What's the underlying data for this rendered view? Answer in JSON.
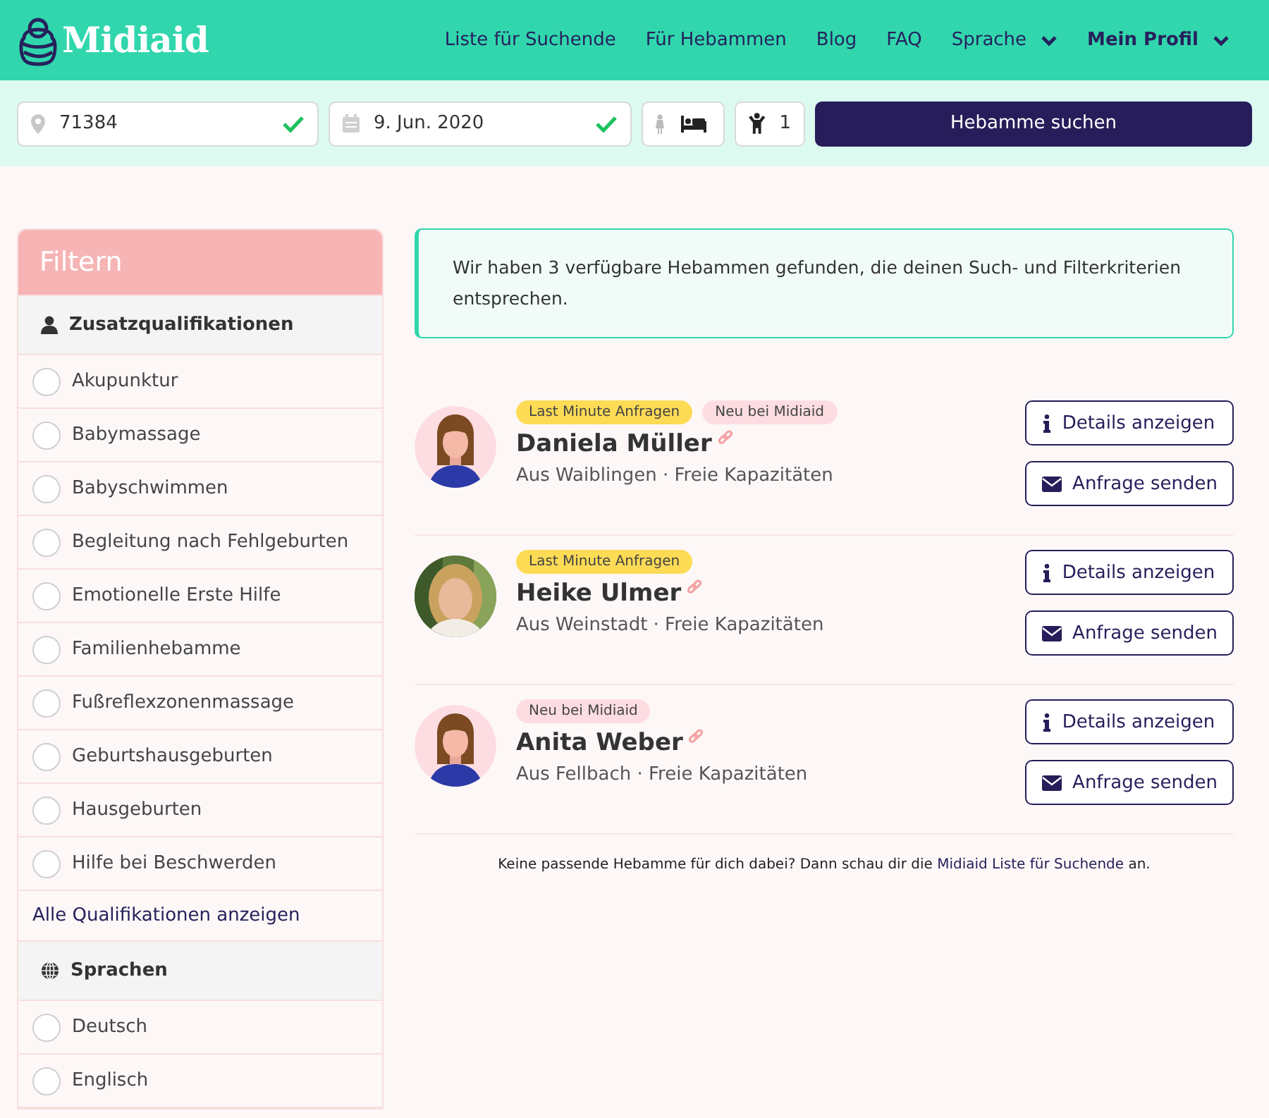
{
  "header": {
    "logo": "Midiaid",
    "nav": [
      {
        "label": "Liste für Suchende",
        "bold": false,
        "dropdown": false
      },
      {
        "label": "Für Hebammen",
        "bold": false,
        "dropdown": false
      },
      {
        "label": "Blog",
        "bold": false,
        "dropdown": false
      },
      {
        "label": "FAQ",
        "bold": false,
        "dropdown": false
      },
      {
        "label": "Sprache",
        "bold": false,
        "dropdown": true
      },
      {
        "label": "Mein Profil",
        "bold": true,
        "dropdown": true
      }
    ]
  },
  "search": {
    "location": {
      "value": "71384",
      "valid": true
    },
    "date": {
      "value": "9. Jun. 2020",
      "valid": true
    },
    "children": "1",
    "button": "Hebamme suchen"
  },
  "filter": {
    "title": "Filtern",
    "sections": [
      {
        "kind": "qualification",
        "title": "Zusatzqualifikationen",
        "items": [
          {
            "label": "Akupunktur",
            "checked": false
          },
          {
            "label": "Babymassage",
            "checked": false
          },
          {
            "label": "Babyschwimmen",
            "checked": false
          },
          {
            "label": "Begleitung nach Fehlgeburten",
            "checked": false
          },
          {
            "label": "Emotionelle Erste Hilfe",
            "checked": false
          },
          {
            "label": "Familienhebamme",
            "checked": false
          },
          {
            "label": "Fußreflexzonenmassage",
            "checked": false
          },
          {
            "label": "Geburtshausgeburten",
            "checked": false
          },
          {
            "label": "Hausgeburten",
            "checked": false
          },
          {
            "label": "Hilfe bei Beschwerden",
            "checked": false
          }
        ],
        "more": "Alle Qualifikationen anzeigen"
      },
      {
        "kind": "language",
        "title": "Sprachen",
        "items": [
          {
            "label": "Deutsch",
            "checked": false
          },
          {
            "label": "Englisch",
            "checked": false
          }
        ]
      }
    ]
  },
  "results": {
    "message": "Wir haben 3 verfügbare Hebammen gefunden, die deinen Such- und Filterkriterien entsprechen.",
    "midwives": [
      {
        "avatar": {
          "kind": "illustration"
        },
        "badges": [
          {
            "kind": "last_minute",
            "label": "Last Minute Anfragen"
          },
          {
            "kind": "new",
            "label": "Neu bei Midiaid"
          }
        ],
        "name": "Daniela Müller",
        "info": "Aus Waiblingen · Freie Kapazitäten",
        "details": "Details anzeigen",
        "request": "Anfrage senden"
      },
      {
        "avatar": {
          "kind": "picture"
        },
        "badges": [
          {
            "kind": "last_minute",
            "label": "Last Minute Anfragen"
          }
        ],
        "name": "Heike Ulmer",
        "info": "Aus Weinstadt · Freie Kapazitäten",
        "details": "Details anzeigen",
        "request": "Anfrage senden"
      },
      {
        "avatar": {
          "kind": "illustration"
        },
        "badges": [
          {
            "kind": "new",
            "label": "Neu bei Midiaid"
          }
        ],
        "name": "Anita Weber",
        "info": "Aus Fellbach · Freie Kapazitäten",
        "details": "Details anzeigen",
        "request": "Anfrage senden"
      }
    ],
    "footer": {
      "text": "Keine passende Hebamme für dich dabei? Dann schau dir die ",
      "link": "Midiaid Liste für Suchende",
      "after": " an."
    }
  }
}
